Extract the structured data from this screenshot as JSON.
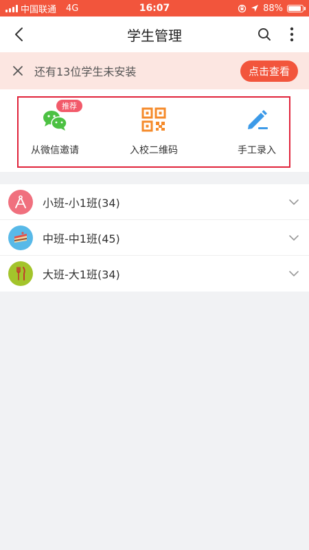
{
  "status_bar": {
    "carrier": "中国联通",
    "network": "4G",
    "time": "16:07",
    "battery": "88%",
    "battery_level": 0.88
  },
  "nav": {
    "title": "学生管理",
    "back_icon": "chevron-left-icon",
    "search_icon": "search-icon",
    "more_icon": "more-vertical-icon"
  },
  "notice": {
    "text": "还有13位学生未安装",
    "button_label": "点击查看"
  },
  "actions": {
    "items": [
      {
        "label": "从微信邀请",
        "icon": "wechat-icon",
        "badge": "推荐"
      },
      {
        "label": "入校二维码",
        "icon": "qr-code-icon"
      },
      {
        "label": "手工录入",
        "icon": "pen-icon"
      }
    ]
  },
  "classes": [
    {
      "name": "小班-小1班(34)",
      "icon": "compass-icon",
      "color": "#f0707e"
    },
    {
      "name": "中班-中1班(45)",
      "icon": "cake-icon",
      "color": "#58b9e8"
    },
    {
      "name": "大班-大1班(34)",
      "icon": "cutlery-icon",
      "color": "#a3c42b"
    }
  ],
  "colors": {
    "brand": "#f2553c",
    "notice_bg": "#fce6e1",
    "highlight_border": "#e0223a",
    "wechat_green": "#4cc142",
    "qr_orange": "#f58a2a",
    "pen_blue": "#3c9ae8"
  }
}
